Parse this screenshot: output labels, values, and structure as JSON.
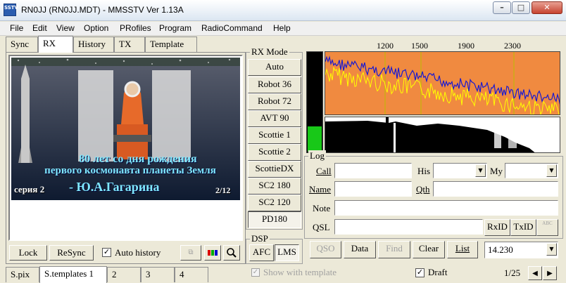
{
  "window": {
    "title": "RN0JJ (RN0JJ.MDT) - MMSSTV Ver 1.13A",
    "app_icon_text": "SSTV",
    "minimize": "–",
    "maximize": "□",
    "close": "✕"
  },
  "menu": [
    "File",
    "Edit",
    "View",
    "Option",
    "PRofiles",
    "Program",
    "RadioCommand",
    "Help"
  ],
  "left_tabs": [
    {
      "label": "Sync",
      "active": false
    },
    {
      "label": "RX",
      "active": true
    },
    {
      "label": "History",
      "active": false
    },
    {
      "label": "TX",
      "active": false
    },
    {
      "label": "Template",
      "active": false
    }
  ],
  "image_overlay": {
    "line1": "80 лет со дня рождения",
    "line2": "первого космонавта планеты Земля",
    "series": "серия 2",
    "name": "- Ю.А.Гагарина",
    "counter": "2/12"
  },
  "bottom_left": {
    "lock": "Lock",
    "resync": "ReSync",
    "auto_history_label": "Auto history",
    "auto_history_checked": true
  },
  "bottom_tabs": [
    {
      "label": "S.pix",
      "active": false
    },
    {
      "label": "S.templates 1",
      "active": true
    },
    {
      "label": "2",
      "active": false
    },
    {
      "label": "3",
      "active": false
    },
    {
      "label": "4",
      "active": false
    }
  ],
  "rx_mode": {
    "title": "RX Mode",
    "modes": [
      {
        "label": "Auto",
        "pressed": false
      },
      {
        "label": "Robot 36",
        "pressed": false
      },
      {
        "label": "Robot 72",
        "pressed": false
      },
      {
        "label": "AVT 90",
        "pressed": false
      },
      {
        "label": "Scottie 1",
        "pressed": false
      },
      {
        "label": "Scottie 2",
        "pressed": false
      },
      {
        "label": "ScottieDX",
        "pressed": false
      },
      {
        "label": "SC2 180",
        "pressed": false
      },
      {
        "label": "SC2 120",
        "pressed": false
      },
      {
        "label": "PD180",
        "pressed": true
      }
    ]
  },
  "dsp": {
    "title": "DSP",
    "afc": "AFC",
    "lms": "LMS"
  },
  "spectrum": {
    "freq_labels": [
      "1200",
      "1500",
      "1900",
      "2300"
    ],
    "background_color": "#f08a40",
    "trace_color_1": "#1a1ad0",
    "trace_color_2": "#ffff00",
    "marker_color": "#c8c800",
    "level_fill_color": "#18c818"
  },
  "log": {
    "title": "Log",
    "call_label": "Call",
    "call_value": "",
    "his_label": "His",
    "my_label": "My",
    "name_label": "Name",
    "name_value": "",
    "qth_label": "Qth",
    "note_label": "Note",
    "qsl_label": "QSL",
    "rxid": "RxID",
    "txid": "TxID",
    "abc_icon_text": "ABC"
  },
  "actions": {
    "qso": "QSO",
    "data": "Data",
    "find": "Find",
    "clear": "Clear",
    "list": "List",
    "freq": "14.230"
  },
  "status": {
    "show_with_template": "Show with template",
    "draft": "Draft",
    "draft_checked": true,
    "page": "1/25"
  }
}
